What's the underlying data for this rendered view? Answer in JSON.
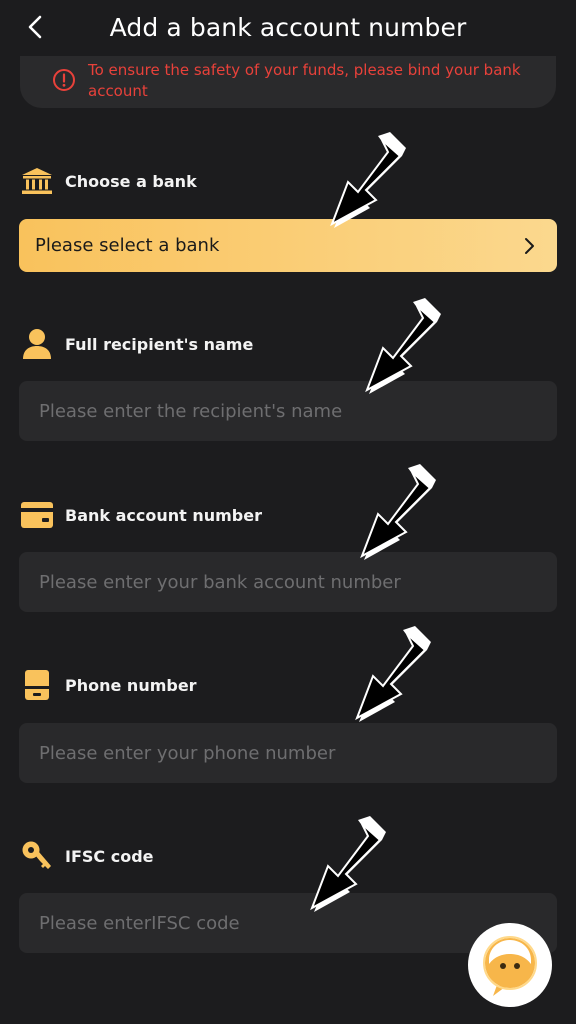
{
  "header": {
    "title": "Add a bank account number"
  },
  "notice": {
    "text": "To ensure the safety of your funds, please bind your bank account"
  },
  "fields": {
    "bank": {
      "label": "Choose a bank",
      "select_text": "Please select a bank",
      "icon": "bank-icon"
    },
    "name": {
      "label": "Full recipient's name",
      "placeholder": "Please enter the recipient's name",
      "value": "",
      "icon": "person-icon"
    },
    "account": {
      "label": "Bank account number",
      "placeholder": "Please enter your bank account number",
      "value": "",
      "icon": "card-icon"
    },
    "phone": {
      "label": "Phone number",
      "placeholder": "Please enter your phone number",
      "value": "",
      "icon": "phone-icon"
    },
    "ifsc": {
      "label": "IFSC code",
      "placeholder": "Please enterIFSC code",
      "value": "",
      "icon": "key-icon"
    }
  },
  "colors": {
    "background": "#1c1c1e",
    "accent_gold": "#f9c25c",
    "warning_red": "#e8413a",
    "input_bg": "#29292b"
  },
  "overlay": {
    "arrow_icon": "pointer-arrow-icon",
    "service_icon": "customer-service-icon"
  }
}
